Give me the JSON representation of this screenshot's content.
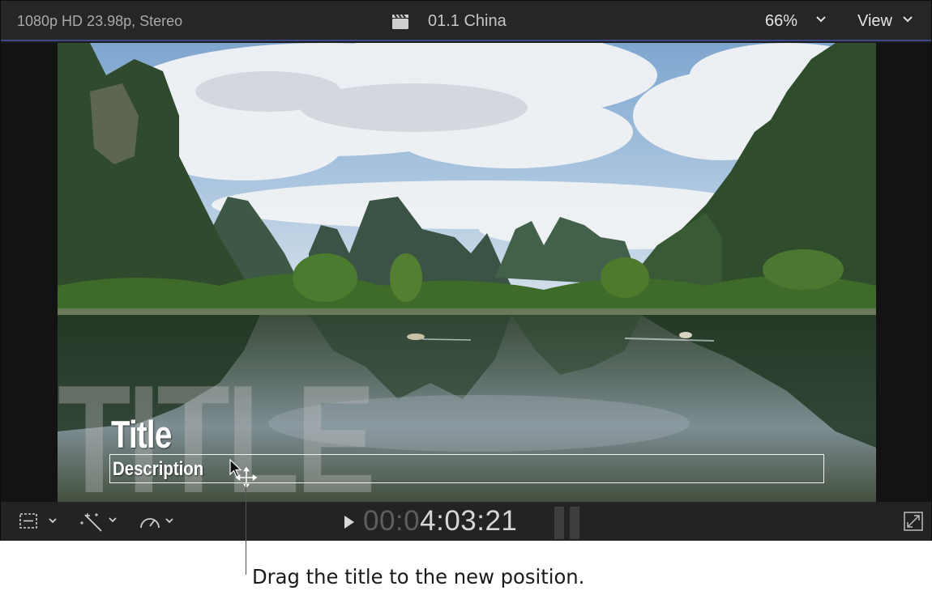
{
  "header": {
    "format": "1080p HD 23.98p, Stereo",
    "clip_icon": "clapperboard-icon",
    "clip_name": "01.1 China",
    "zoom": "66%",
    "view_label": "View"
  },
  "overlay": {
    "background_word": "TITLE",
    "title": "Title",
    "description": "Description"
  },
  "footer": {
    "timecode_dim": "00:0",
    "timecode_main": "4:03:21",
    "icons": [
      "transform-icon",
      "magic-wand-icon",
      "speed-icon",
      "play-icon",
      "audio-meter-icon",
      "fullscreen-icon"
    ]
  },
  "callout": "Drag the title to the new position.",
  "colors": {
    "toolbar": "#262628",
    "accent_line": "#3b4a86",
    "text": "#c8c8c8"
  }
}
